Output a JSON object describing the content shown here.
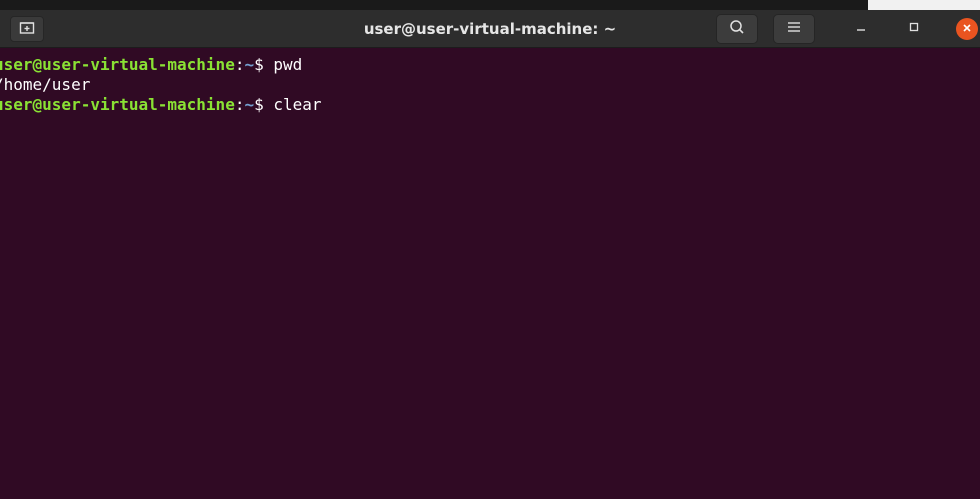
{
  "window": {
    "title": "user@user-virtual-machine: ~"
  },
  "header": {
    "new_tab_icon": "new-tab-icon",
    "search_icon": "search-icon",
    "menu_icon": "hamburger-menu-icon",
    "minimize_icon": "minimize-icon",
    "maximize_icon": "maximize-icon",
    "close_icon": "close-icon"
  },
  "colors": {
    "terminal_bg": "#300a24",
    "prompt_user": "#8ae234",
    "prompt_path": "#729fcf",
    "close_button": "#e95420"
  },
  "terminal": {
    "lines": [
      {
        "type": "prompt",
        "user_host": "user@user-virtual-machine",
        "colon": ":",
        "path": "~",
        "symbol": "$ ",
        "command": "pwd"
      },
      {
        "type": "output",
        "text": "/home/user"
      },
      {
        "type": "prompt",
        "user_host": "user@user-virtual-machine",
        "colon": ":",
        "path": "~",
        "symbol": "$ ",
        "command": "clear"
      }
    ]
  }
}
